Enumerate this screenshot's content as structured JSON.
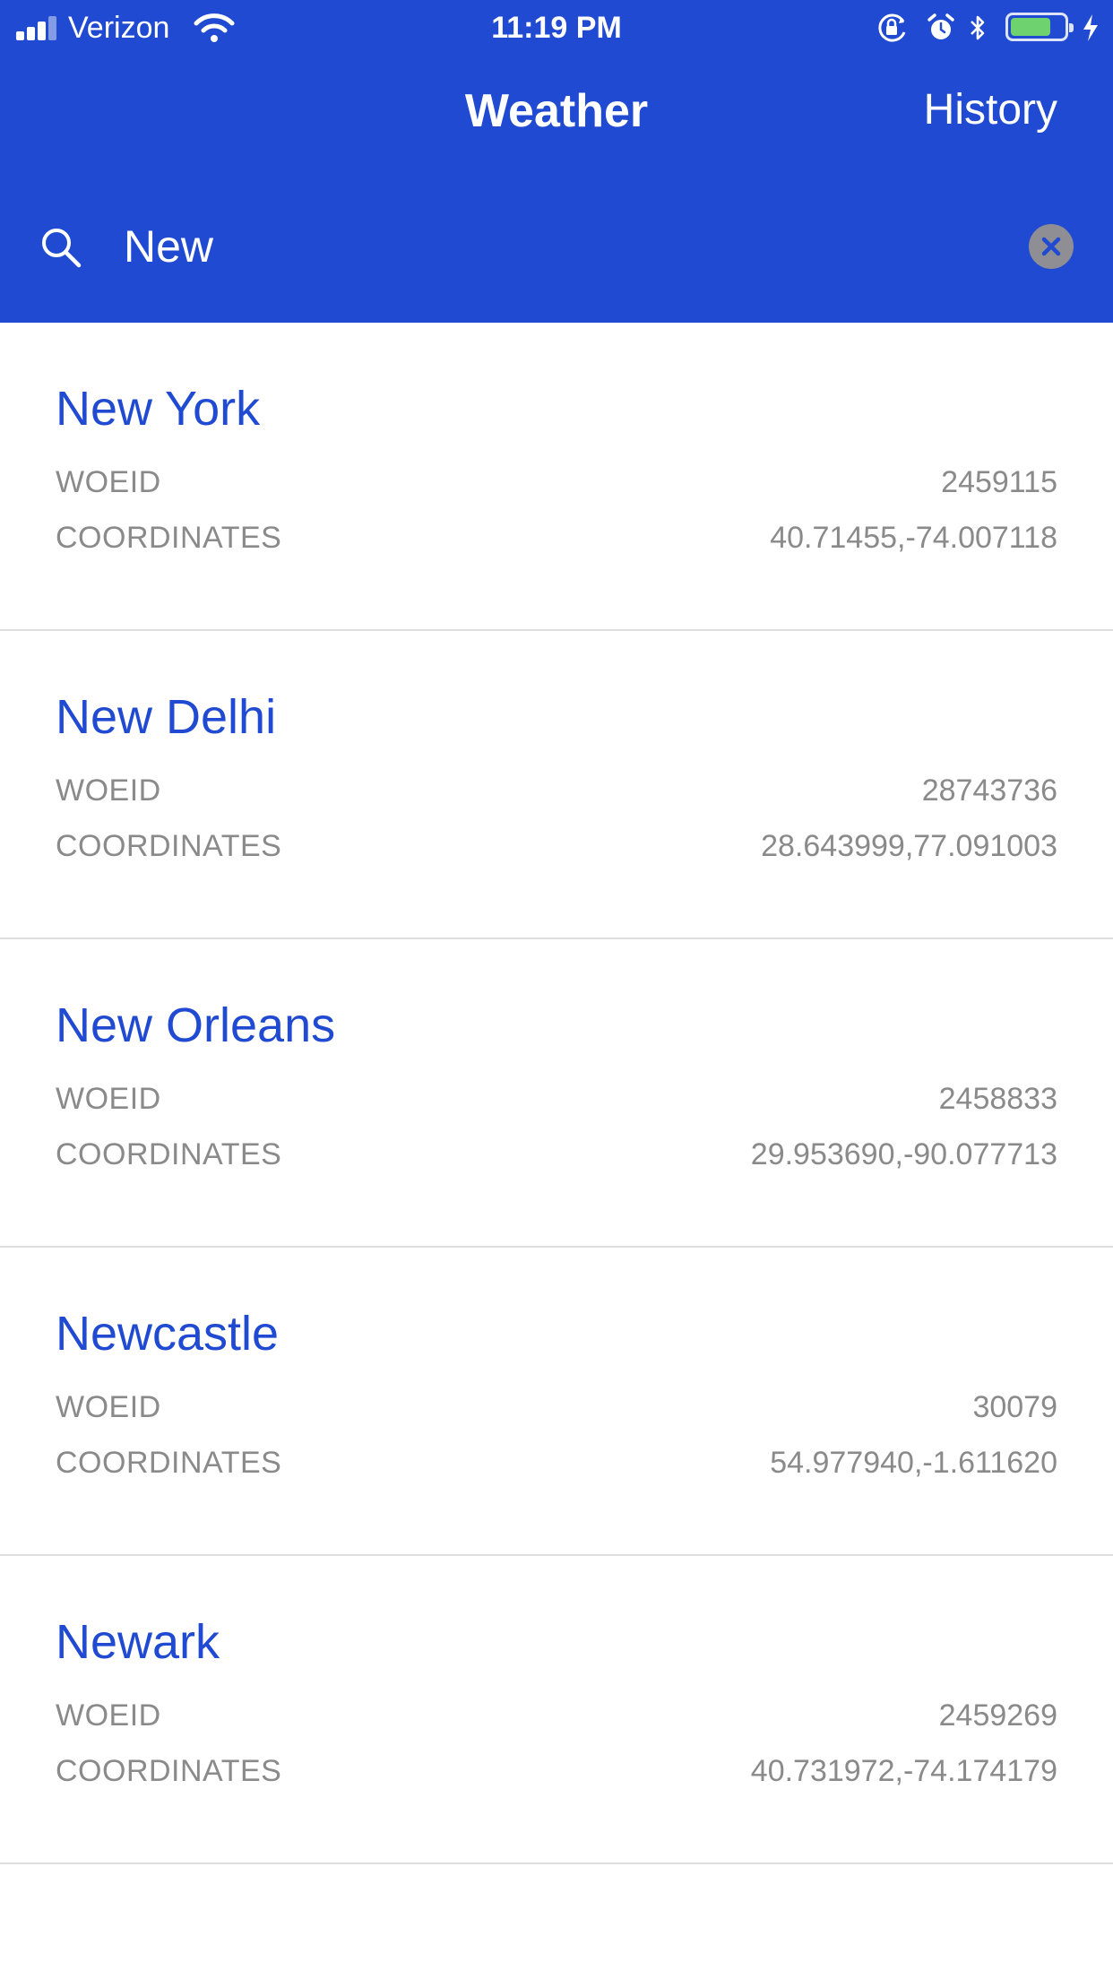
{
  "status_bar": {
    "carrier": "Verizon",
    "time": "11:19 PM",
    "battery_level": 0.75,
    "battery_color": "#6ed36e"
  },
  "nav": {
    "title": "Weather",
    "history_label": "History"
  },
  "search": {
    "value": "New",
    "icon": "search-icon",
    "clear_icon": "clear-icon"
  },
  "labels": {
    "woeid": "WOEID",
    "coordinates": "COORDINATES"
  },
  "results": [
    {
      "name": "New York",
      "woeid": "2459115",
      "coordinates": "40.71455,-74.007118"
    },
    {
      "name": "New Delhi",
      "woeid": "28743736",
      "coordinates": "28.643999,77.091003"
    },
    {
      "name": "New Orleans",
      "woeid": "2458833",
      "coordinates": "29.953690,-90.077713"
    },
    {
      "name": "Newcastle",
      "woeid": "30079",
      "coordinates": "54.977940,-1.611620"
    },
    {
      "name": "Newark",
      "woeid": "2459269",
      "coordinates": "40.731972,-74.174179"
    }
  ],
  "colors": {
    "brand": "#1f4ad1",
    "secondary_text": "#8a8a8a",
    "divider": "#dedede"
  }
}
